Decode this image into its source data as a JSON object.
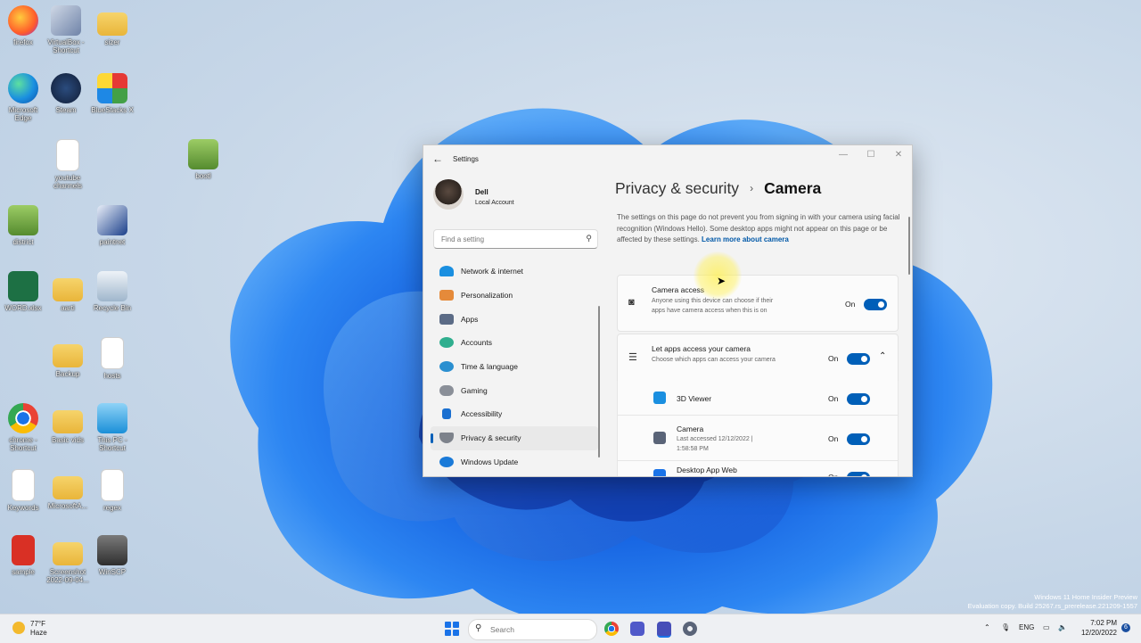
{
  "desktop": {
    "icons": [
      {
        "label": "firefox",
        "icon": "firefox-icon"
      },
      {
        "label": "VirtualBox - Shortcut",
        "icon": "virtualbox-icon"
      },
      {
        "label": "sizer",
        "icon": "folder-icon"
      },
      {
        "label": "Microsoft Edge",
        "icon": "edge-icon"
      },
      {
        "label": "Steam",
        "icon": "steam-icon"
      },
      {
        "label": "BlueStacks X",
        "icon": "bluestacks-icon"
      },
      {
        "label": "youtube channels",
        "icon": "file-icon"
      },
      {
        "label": "bootl",
        "icon": "notepad-icon"
      },
      {
        "label": "district",
        "icon": "notepad-icon"
      },
      {
        "label": "paintnet",
        "icon": "paintnet-icon"
      },
      {
        "label": "WORD.xlsx",
        "icon": "excel-icon"
      },
      {
        "label": "aarti",
        "icon": "folder-icon"
      },
      {
        "label": "Recycle Bin",
        "icon": "recycle-bin-icon"
      },
      {
        "label": "Backup",
        "icon": "folder-icon"
      },
      {
        "label": "hosts",
        "icon": "file-icon"
      },
      {
        "label": "chrome - Shortcut",
        "icon": "chrome-icon"
      },
      {
        "label": "Basic vids",
        "icon": "folder-icon"
      },
      {
        "label": "This PC - Shortcut",
        "icon": "monitor-icon"
      },
      {
        "label": "Keywords",
        "icon": "file-icon"
      },
      {
        "label": "MicrosoftA...",
        "icon": "folder-icon"
      },
      {
        "label": "regex",
        "icon": "file-icon"
      },
      {
        "label": "sample",
        "icon": "pdf-icon"
      },
      {
        "label": "Screenshot 2022-09-04...",
        "icon": "folder-icon"
      },
      {
        "label": "WinSCP",
        "icon": "winscp-icon"
      }
    ]
  },
  "settings": {
    "window_title": "Settings",
    "user": {
      "name": "Dell",
      "account": "Local Account"
    },
    "search_placeholder": "Find a setting",
    "nav": [
      {
        "label": "Network & internet",
        "icon": "wifi-icon",
        "color": "#1a8fe0"
      },
      {
        "label": "Personalization",
        "icon": "brush-icon",
        "color": "#e58a3a"
      },
      {
        "label": "Apps",
        "icon": "apps-icon",
        "color": "#5b6b86"
      },
      {
        "label": "Accounts",
        "icon": "person-icon",
        "color": "#2fae8e"
      },
      {
        "label": "Time & language",
        "icon": "globe-icon",
        "color": "#2a8fd0"
      },
      {
        "label": "Gaming",
        "icon": "controller-icon",
        "color": "#8a8f98"
      },
      {
        "label": "Accessibility",
        "icon": "accessibility-icon",
        "color": "#1a6fd0"
      },
      {
        "label": "Privacy & security",
        "icon": "shield-icon",
        "color": "#7d828b",
        "active": true
      },
      {
        "label": "Windows Update",
        "icon": "refresh-icon",
        "color": "#1a7ad8"
      }
    ],
    "breadcrumb": {
      "parent": "Privacy & security",
      "separator": "›",
      "current": "Camera"
    },
    "info_text": "The settings on this page do not prevent you from signing in with your camera using facial recognition (Windows Hello). Some desktop apps might not appear on this page or be affected by these settings.",
    "info_link": "Learn more about camera",
    "camera_access": {
      "title": "Camera access",
      "description": "Anyone using this device can choose if their apps have camera access when this is on",
      "state": "On"
    },
    "let_apps": {
      "title": "Let apps access your camera",
      "description": "Choose which apps can access your camera",
      "state": "On"
    },
    "apps": [
      {
        "name": "3D Viewer",
        "detail": "",
        "state": "On",
        "color": "#1a8fe0"
      },
      {
        "name": "Camera",
        "detail": "Last accessed 12/12/2022 | 1:58:58 PM",
        "state": "On",
        "color": "#5a6478"
      },
      {
        "name": "Desktop App Web",
        "detail": "",
        "state": "On",
        "color": "#1a73e8"
      }
    ]
  },
  "watermark": {
    "line1": "Windows 11 Home Insider Preview",
    "line2": "Evaluation copy. Build 25267.rs_prerelease.221209-1557"
  },
  "taskbar": {
    "weather_temp": "77°F",
    "weather_desc": "Haze",
    "search_placeholder": "Search",
    "language": "ENG",
    "time": "7:02 PM",
    "date": "12/20/2022",
    "notification_count": "6",
    "accent": "#1a73e8"
  }
}
